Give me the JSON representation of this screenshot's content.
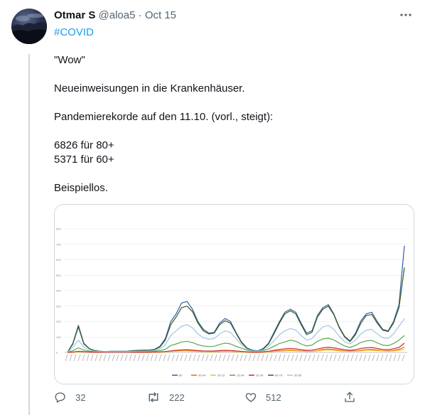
{
  "tweet": {
    "author_name": "Otmar S",
    "handle": "@aloa5",
    "date": "Oct 15",
    "hashtag": "#COVID",
    "lines": [
      "\"Wow\"",
      "Neueinweisungen in die Krankenhäuser.",
      "Pandemierekorde auf den 11.10. (vorl., steigt):",
      "6826 für 80+",
      "5371 für 60+",
      "Beispiellos."
    ],
    "more_icon": "more-icon"
  },
  "actions": {
    "reply_count": "32",
    "retweet_count": "222",
    "like_count": "512"
  },
  "chart_data": {
    "type": "line",
    "y_ticks": [
      "800",
      "700",
      "600",
      "500",
      "400",
      "300",
      "200",
      "100",
      "0"
    ],
    "ylim": [
      0,
      800
    ],
    "grid": true,
    "legend_position": "bottom",
    "legend": [
      "80",
      "00-04",
      "05-15",
      "15-34",
      "25-34",
      "60-79",
      "35-59"
    ],
    "series": [
      {
        "name": "80",
        "color": "#2e5fa8",
        "values": [
          2,
          55,
          165,
          55,
          25,
          12,
          8,
          6,
          8,
          8,
          8,
          8,
          12,
          14,
          15,
          15,
          20,
          40,
          90,
          200,
          250,
          320,
          330,
          280,
          200,
          150,
          125,
          130,
          190,
          220,
          200,
          130,
          70,
          30,
          15,
          10,
          25,
          60,
          130,
          200,
          260,
          280,
          260,
          190,
          125,
          140,
          240,
          290,
          310,
          250,
          165,
          105,
          75,
          125,
          205,
          250,
          260,
          200,
          150,
          140,
          200,
          310,
          690
        ]
      },
      {
        "name": "00-04",
        "color": "#e8622b",
        "values": [
          0,
          2,
          5,
          4,
          2,
          1,
          1,
          1,
          1,
          1,
          1,
          1,
          1,
          1,
          1,
          1,
          1,
          2,
          4,
          8,
          10,
          12,
          12,
          10,
          8,
          6,
          5,
          5,
          7,
          8,
          8,
          6,
          4,
          2,
          1,
          1,
          2,
          4,
          8,
          12,
          14,
          16,
          14,
          10,
          8,
          8,
          12,
          20,
          22,
          20,
          15,
          10,
          8,
          10,
          14,
          18,
          20,
          16,
          12,
          10,
          14,
          20,
          35
        ]
      },
      {
        "name": "05-15",
        "color": "#f2c12e",
        "values": [
          0,
          2,
          5,
          4,
          2,
          1,
          1,
          1,
          1,
          1,
          1,
          1,
          1,
          1,
          1,
          1,
          1,
          2,
          4,
          6,
          8,
          10,
          10,
          8,
          6,
          5,
          4,
          4,
          6,
          7,
          6,
          5,
          3,
          2,
          1,
          1,
          2,
          3,
          6,
          8,
          10,
          12,
          10,
          8,
          6,
          6,
          10,
          14,
          16,
          14,
          10,
          8,
          6,
          8,
          10,
          14,
          14,
          12,
          10,
          8,
          10,
          14,
          20
        ]
      },
      {
        "name": "15-34",
        "color": "#5aa648",
        "values": [
          1,
          12,
          30,
          15,
          8,
          4,
          3,
          3,
          3,
          3,
          3,
          3,
          4,
          5,
          6,
          6,
          8,
          12,
          20,
          45,
          55,
          68,
          72,
          64,
          50,
          42,
          38,
          40,
          52,
          60,
          55,
          40,
          28,
          15,
          8,
          8,
          12,
          22,
          40,
          58,
          68,
          80,
          72,
          55,
          42,
          48,
          72,
          88,
          92,
          82,
          60,
          42,
          32,
          45,
          65,
          75,
          78,
          62,
          48,
          44,
          58,
          80,
          110
        ]
      },
      {
        "name": "25-34",
        "color": "#c62f2f",
        "values": [
          0,
          3,
          8,
          5,
          3,
          2,
          1,
          1,
          1,
          1,
          1,
          1,
          1,
          2,
          2,
          2,
          3,
          4,
          6,
          10,
          14,
          16,
          18,
          15,
          12,
          10,
          9,
          9,
          12,
          14,
          13,
          10,
          7,
          4,
          2,
          2,
          4,
          8,
          14,
          20,
          24,
          26,
          24,
          18,
          14,
          15,
          22,
          30,
          34,
          30,
          24,
          18,
          14,
          18,
          26,
          30,
          32,
          26,
          20,
          18,
          24,
          32,
          60
        ]
      },
      {
        "name": "60-79",
        "color": "#3e5a1d",
        "values": [
          2,
          60,
          175,
          60,
          25,
          12,
          8,
          6,
          7,
          7,
          7,
          7,
          10,
          12,
          14,
          14,
          18,
          35,
          80,
          180,
          230,
          290,
          300,
          265,
          190,
          140,
          120,
          125,
          180,
          205,
          190,
          125,
          65,
          28,
          12,
          8,
          22,
          55,
          120,
          190,
          250,
          270,
          250,
          180,
          115,
          130,
          230,
          280,
          300,
          245,
          160,
          100,
          70,
          115,
          190,
          240,
          245,
          190,
          145,
          135,
          190,
          290,
          550
        ]
      },
      {
        "name": "35-59",
        "color": "#9fc5ea",
        "values": [
          1,
          35,
          80,
          35,
          15,
          8,
          6,
          5,
          5,
          5,
          5,
          5,
          7,
          8,
          9,
          9,
          12,
          22,
          50,
          110,
          140,
          170,
          180,
          160,
          120,
          95,
          85,
          90,
          120,
          140,
          130,
          90,
          50,
          22,
          10,
          8,
          16,
          38,
          75,
          115,
          140,
          155,
          145,
          110,
          80,
          90,
          130,
          165,
          175,
          150,
          105,
          70,
          55,
          80,
          120,
          145,
          150,
          120,
          95,
          90,
          120,
          170,
          220
        ]
      }
    ]
  }
}
